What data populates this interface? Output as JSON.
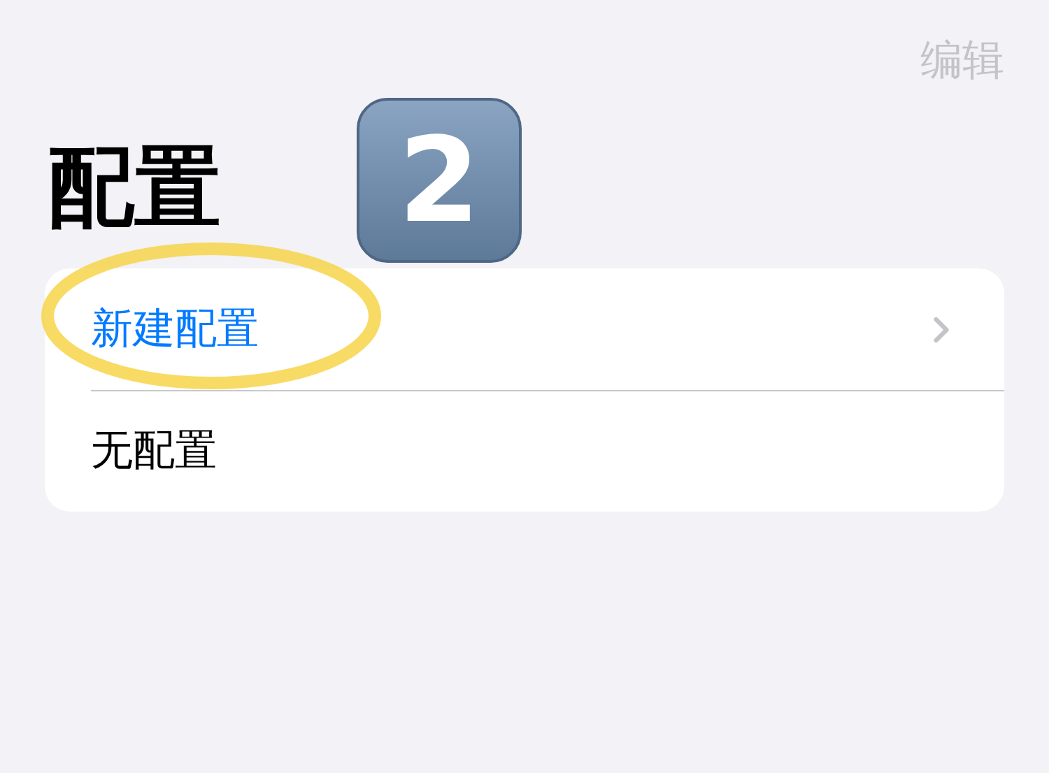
{
  "nav": {
    "edit": {
      "label": "编辑",
      "disabled": true
    }
  },
  "title": "配置",
  "badge": {
    "label": "2"
  },
  "rows": [
    {
      "label": "新建配置",
      "kind": "action",
      "highlighted": true
    },
    {
      "label": "无配置",
      "kind": "plain",
      "highlighted": false
    }
  ]
}
